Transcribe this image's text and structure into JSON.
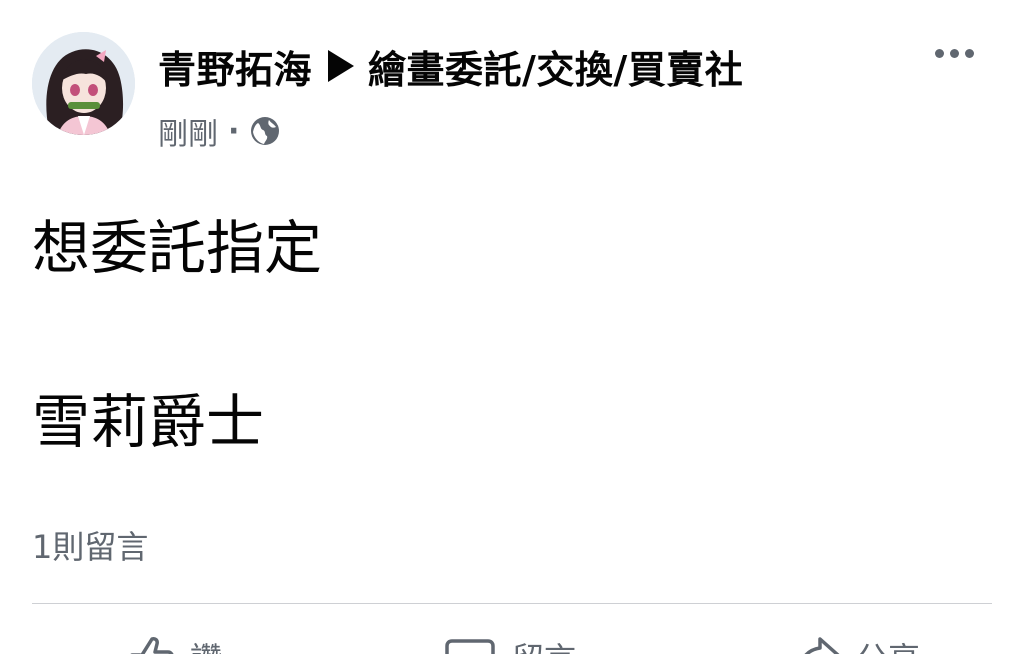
{
  "post": {
    "author": "青野拓海",
    "group": "繪畫委託/交換/買賣社",
    "timestamp": "剛剛",
    "separator": "·",
    "privacy_icon": "globe-icon",
    "body_line_1": "想委託指定",
    "body_line_2": "雪莉爵士",
    "comment_count": "1則留言"
  },
  "actions": {
    "like_label": "讚",
    "comment_label": "留言",
    "share_label": "分享"
  },
  "icons": {
    "more": "more-dots-icon",
    "arrow": "arrow-right-icon",
    "like": "thumbs-up-icon",
    "comment": "comment-bubble-icon",
    "share": "share-arrow-icon"
  },
  "colors": {
    "text_primary": "#050505",
    "text_secondary": "#606770",
    "divider": "#ced0d4"
  }
}
